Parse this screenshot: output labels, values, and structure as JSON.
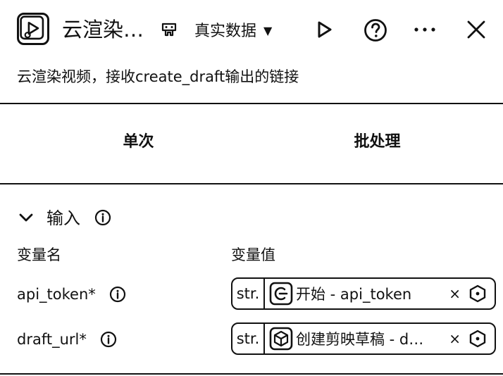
{
  "header": {
    "title": "云渲染…",
    "data_mode": "真实数据",
    "icons": [
      "video-render-icon",
      "model-icon",
      "caret-down-icon",
      "play-icon",
      "help-icon",
      "more-icon",
      "close-icon"
    ]
  },
  "description": "云渲染视频，接收create_draft输出的链接",
  "tabs": [
    {
      "label": "单次"
    },
    {
      "label": "批处理"
    }
  ],
  "inputs_section": {
    "title": "输入",
    "col_name": "变量名",
    "col_value": "变量值",
    "rows": [
      {
        "name": "api_token*",
        "type": "str.",
        "ref": "开始 - api_token"
      },
      {
        "name": "draft_url*",
        "type": "str.",
        "ref": "创建剪映草稿 - d…"
      }
    ],
    "clear_symbol": "×"
  }
}
